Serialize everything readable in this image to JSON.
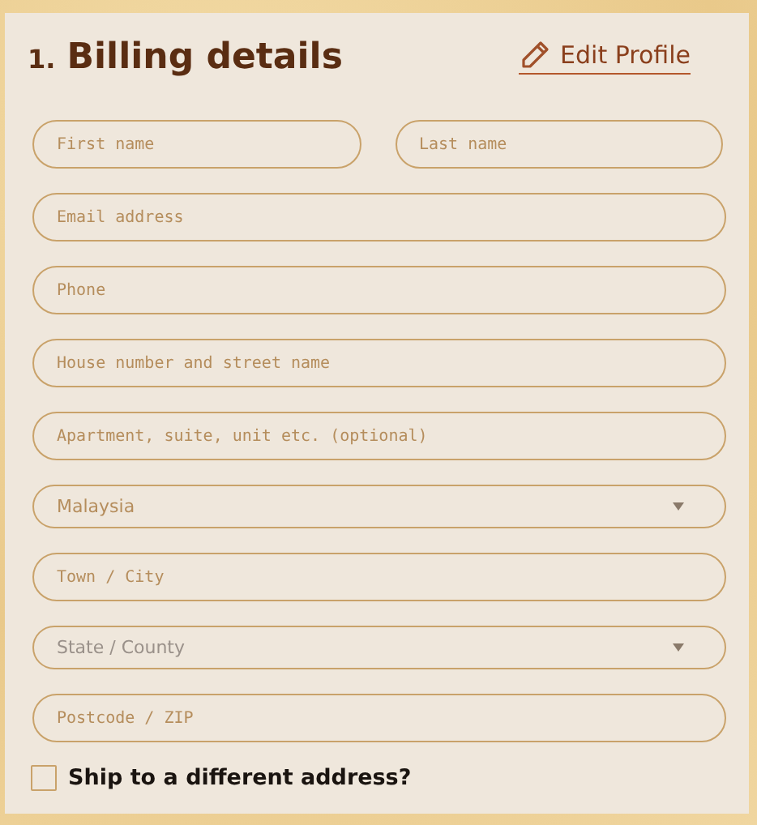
{
  "heading": {
    "number": "1.",
    "title": "Billing details"
  },
  "edit_link": {
    "label": "Edit Profile"
  },
  "fields": [
    {
      "kind": "pair",
      "items": [
        {
          "kind": "text",
          "placeholder": "First name"
        },
        {
          "kind": "text",
          "placeholder": "Last name"
        }
      ]
    },
    {
      "kind": "text",
      "placeholder": "Email address"
    },
    {
      "kind": "text",
      "placeholder": "Phone"
    },
    {
      "kind": "text",
      "placeholder": "House number and street name"
    },
    {
      "kind": "text",
      "placeholder": "Apartment, suite, unit etc. (optional)"
    },
    {
      "kind": "select",
      "value": "Malaysia"
    },
    {
      "kind": "text",
      "placeholder": "Town / City"
    },
    {
      "kind": "select",
      "placeholder": "State / County"
    },
    {
      "kind": "text",
      "placeholder": "Postcode / ZIP"
    }
  ],
  "ship_different": {
    "label": "Ship to a different address?",
    "checked": false
  }
}
